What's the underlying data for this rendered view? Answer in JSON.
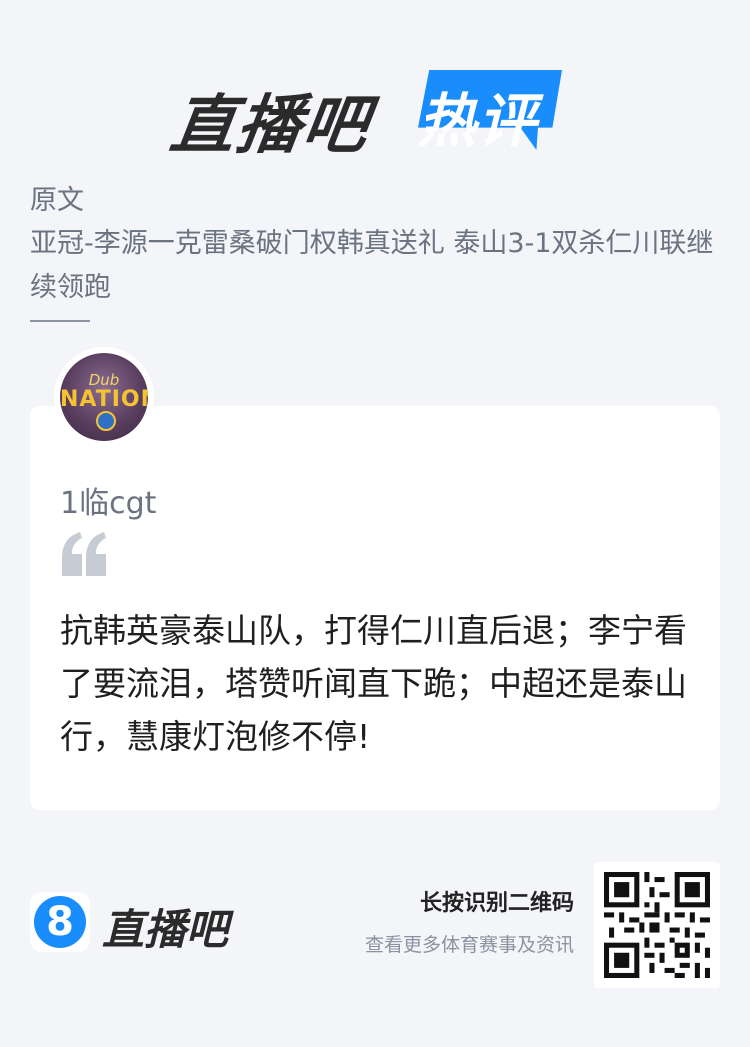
{
  "header": {
    "logo_main": "直播吧",
    "logo_badge": "热评",
    "badge_color": "#1a8dfc"
  },
  "original": {
    "label": "原文",
    "title": "亚冠-李源一克雷桑破门权韩真送礼 泰山3-1双杀仁川联继续领跑"
  },
  "comment": {
    "avatar_top": "Dub",
    "avatar_main": "NATION",
    "username": "1临cgt",
    "quote_icon": "quote-icon",
    "text": "抗韩英豪泰山队，打得仁川直后退；李宁看了要流泪，塔赞听闻直下跪；中超还是泰山行，慧康灯泡修不停!"
  },
  "footer": {
    "logo_number": "8",
    "logo_text": "直播吧",
    "scan_text": "长按识别二维码",
    "sub_text": "查看更多体育赛事及资讯",
    "qr_icon": "qr-code-icon"
  }
}
